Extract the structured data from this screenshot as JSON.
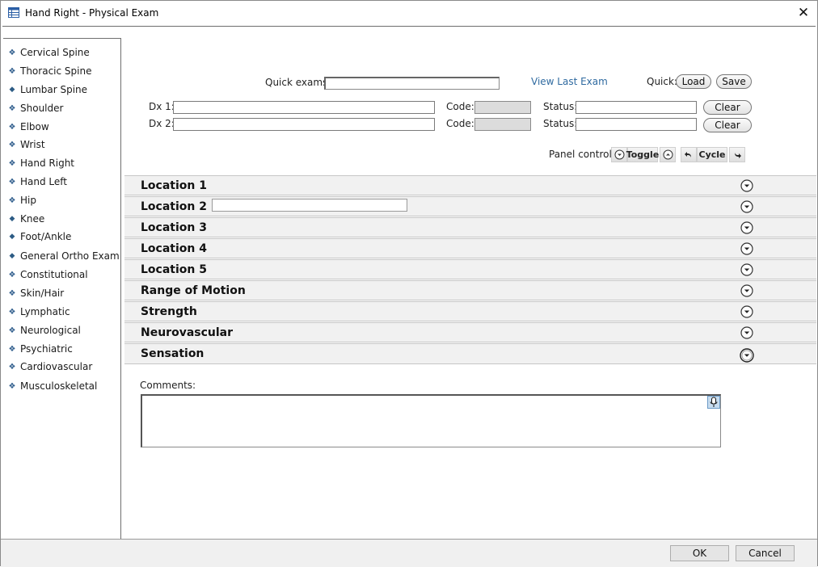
{
  "window": {
    "title": "Hand Right - Physical Exam",
    "close_glyph": "✕",
    "icon": "table-window-icon"
  },
  "sidebar": {
    "items": [
      {
        "label": "Cervical Spine",
        "bullet": "❖"
      },
      {
        "label": "Thoracic Spine",
        "bullet": "❖"
      },
      {
        "label": "Lumbar Spine",
        "bullet": "◆"
      },
      {
        "label": "Shoulder",
        "bullet": "❖"
      },
      {
        "label": "Elbow",
        "bullet": "❖"
      },
      {
        "label": "Wrist",
        "bullet": "❖"
      },
      {
        "label": "Hand Right",
        "bullet": "❖"
      },
      {
        "label": "Hand Left",
        "bullet": "❖"
      },
      {
        "label": "Hip",
        "bullet": "❖"
      },
      {
        "label": "Knee",
        "bullet": "◆"
      },
      {
        "label": "Foot/Ankle",
        "bullet": "◆"
      },
      {
        "label": "General Ortho Exam",
        "bullet": "◆"
      },
      {
        "label": "Constitutional",
        "bullet": "❖"
      },
      {
        "label": "Skin/Hair",
        "bullet": "❖"
      },
      {
        "label": "Lymphatic",
        "bullet": "❖"
      },
      {
        "label": "Neurological",
        "bullet": "❖"
      },
      {
        "label": "Psychiatric",
        "bullet": "❖"
      },
      {
        "label": "Cardiovascular",
        "bullet": "❖"
      },
      {
        "label": "Musculoskeletal",
        "bullet": "❖"
      }
    ]
  },
  "quick": {
    "quick_exams_label": "Quick exams:",
    "quick_exams_value": "",
    "view_last_exam": "View Last Exam",
    "quick_label": "Quick:",
    "load": "Load",
    "save": "Save"
  },
  "dx": [
    {
      "label": "Dx 1:",
      "value": "",
      "code_label": "Code:",
      "code_value": "",
      "status_label": "Status:",
      "status_value": "",
      "clear": "Clear"
    },
    {
      "label": "Dx 2:",
      "value": "",
      "code_label": "Code:",
      "code_value": "",
      "status_label": "Status:",
      "status_value": "",
      "clear": "Clear"
    }
  ],
  "panel_control": {
    "label": "Panel control:",
    "toggle": "Toggle",
    "cycle": "Cycle"
  },
  "panels": [
    {
      "title": "Location 1"
    },
    {
      "title": "Location 2",
      "input_value": ""
    },
    {
      "title": "Location 3"
    },
    {
      "title": "Location 4"
    },
    {
      "title": "Location 5"
    },
    {
      "title": "Range of Motion"
    },
    {
      "title": "Strength"
    },
    {
      "title": "Neurovascular"
    },
    {
      "title": "Sensation"
    }
  ],
  "comments": {
    "label": "Comments:",
    "value": ""
  },
  "footer": {
    "ok": "OK",
    "cancel": "Cancel"
  },
  "colors": {
    "link": "#2f6aa0",
    "bullet": "#2f5d8c",
    "panel_bg": "#f1f1f1"
  }
}
